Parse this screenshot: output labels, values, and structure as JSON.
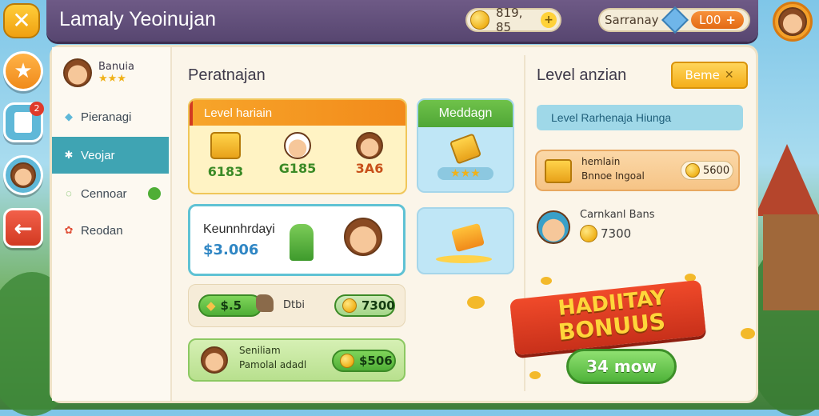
{
  "header": {
    "title": "Lamaly Yeoinujan",
    "coins": "819, 85",
    "player_name": "Sarranay",
    "gems": "L00"
  },
  "sidebar": {
    "profile": {
      "name": "Banuia",
      "stars": "★★★"
    },
    "items": [
      {
        "label": "Pieranagi",
        "icon": "tag-icon"
      },
      {
        "label": "Veojar",
        "icon": "star-icon"
      },
      {
        "label": "Cennoar",
        "icon": "circle-icon"
      },
      {
        "label": "Reodan",
        "icon": "flower-icon"
      }
    ],
    "notification_badge": "2"
  },
  "main": {
    "title": "Peratnajan",
    "featured": {
      "header": "Level hariain",
      "items": [
        {
          "value": "6183",
          "icon": "gold-bar-icon"
        },
        {
          "value": "G185",
          "icon": "chef-avatar-icon"
        },
        {
          "value": "3A6",
          "icon": "girl-avatar-icon"
        }
      ]
    },
    "side_card": {
      "header": "Meddagn",
      "stars": "★★★"
    },
    "offer": {
      "name": "Keunnhrdayi",
      "price": "$3.006"
    },
    "rows": [
      {
        "value": "$.5",
        "label": "Dtbi",
        "price": "7300"
      },
      {
        "title": "Seniliam",
        "subtitle": "Pamolal adadl",
        "price": "$506"
      }
    ]
  },
  "right": {
    "title": "Level anzian",
    "button_label": "Beme",
    "tab_label": "Level Rarhenaja Hiunga",
    "reward1": {
      "title": "hemlain",
      "subtitle": "Bnnoe Ingoal",
      "price": "5600"
    },
    "reward2": {
      "title": "Carnkanl Bans",
      "price": "7300"
    }
  },
  "bonus": {
    "line1": "HADIITAY",
    "line2": "BONUUS",
    "button_label": "34 mow"
  },
  "colors": {
    "teal": "#3fa4b3",
    "orange": "#f29a1f",
    "green": "#4fae36",
    "purple": "#574670"
  }
}
